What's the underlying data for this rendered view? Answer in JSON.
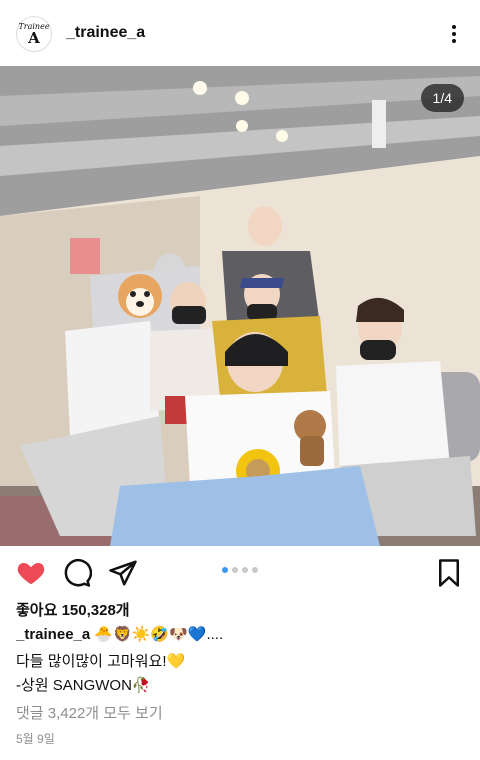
{
  "header": {
    "avatar_line1": "Trainee",
    "avatar_line2": "A",
    "username": "_trainee_a",
    "more_icon": "more-vertical-icon"
  },
  "post": {
    "photo_description_icon": "group-photo",
    "counter": "1/4",
    "carousel": {
      "total": 4,
      "active": 1
    }
  },
  "actions": {
    "like_icon": "heart-filled-icon",
    "like_color": "#ed4956",
    "comment_icon": "comment-icon",
    "share_icon": "send-icon",
    "save_icon": "bookmark-icon"
  },
  "likes_text": "좋아요 150,328개",
  "caption": {
    "username": "_trainee_a",
    "line1_text": "🐣🦁☀️🤣🐶💙....",
    "line2": "다들 많이많이 고마워요!💛",
    "line3": "-상원 SANGWON🥀"
  },
  "comments_link": "댓글 3,422개 모두 보기",
  "date": "5월 9일",
  "colors": {
    "accent": "#3897f0",
    "muted": "#8e8e8e"
  }
}
